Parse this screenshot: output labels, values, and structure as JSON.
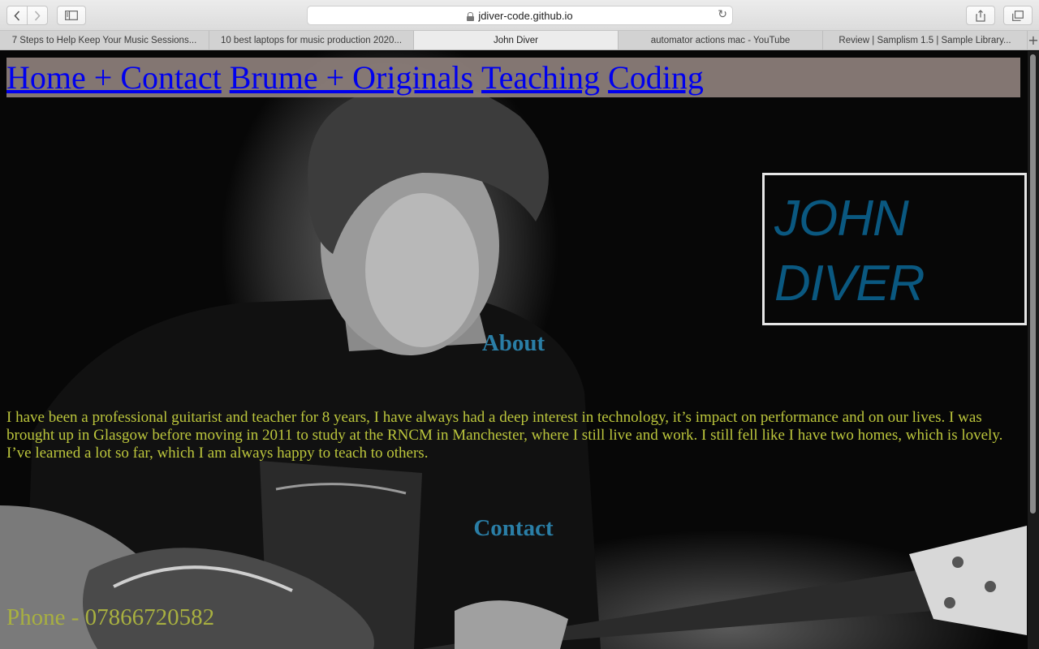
{
  "browser": {
    "url": "jdiver-code.github.io",
    "tabs": [
      {
        "label": "7 Steps to Help Keep Your Music Sessions..."
      },
      {
        "label": "10 best laptops for music production 2020..."
      },
      {
        "label": "John Diver"
      },
      {
        "label": "automator actions mac - YouTube"
      },
      {
        "label": "Review | Samplism 1.5 | Sample Library..."
      }
    ],
    "icons": {
      "back": "chevron-left-icon",
      "forward": "chevron-right-icon",
      "sidebar": "sidebar-icon",
      "lock": "lock-icon",
      "reload": "reload-icon",
      "share": "share-icon",
      "tabs": "tabs-overview-icon",
      "new_tab": "plus-icon"
    }
  },
  "site": {
    "nav": [
      {
        "label": "Home + Contact"
      },
      {
        "label": "Brume + Originals"
      },
      {
        "label": "Teaching"
      },
      {
        "label": "Coding"
      }
    ],
    "name_line1": "JOHN",
    "name_line2": "DIVER",
    "about_heading": "About",
    "about_text": "I have been a professional guitarist and teacher for 8 years, I have always had a deep interest in technology, it’s impact on performance and on our lives. I was brought up in Glasgow before moving in 2011 to study at the RNCM in Manchester, where I still live and work. I still fell like I have two homes, which is lovely. I’ve learned a lot so far, which I am always happy to teach to others.",
    "contact_heading": "Contact",
    "phone": "Phone - 07866720582"
  },
  "colors": {
    "nav_bg": "#8e807c",
    "link": "#0000ee",
    "name": "#0a5880",
    "heading": "#2a7ea6",
    "body_text": "#bcc63c",
    "phone": "#a8b040"
  }
}
